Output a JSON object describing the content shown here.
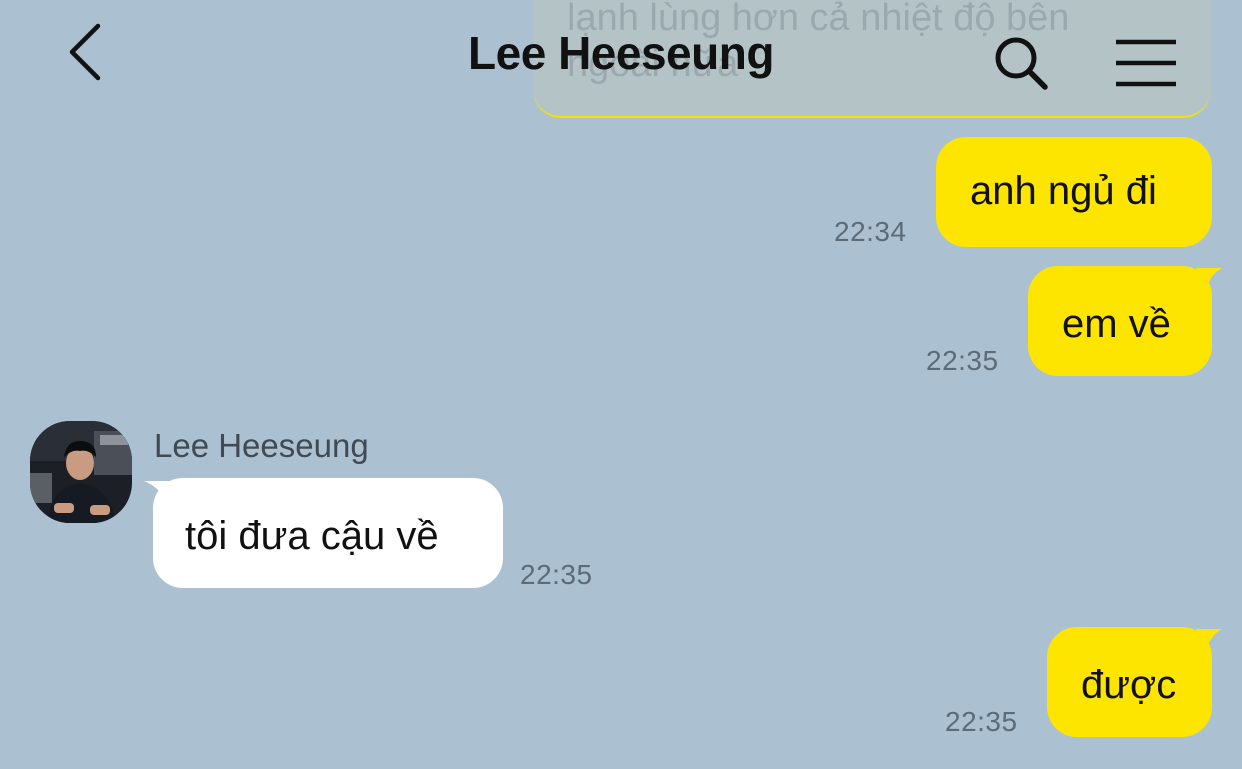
{
  "header": {
    "title": "Lee Heeseung",
    "back_icon": "chevron-left-icon",
    "search_icon": "search-icon",
    "menu_icon": "hamburger-menu-icon"
  },
  "previous_message": {
    "line1": "lạnh lùng hơn cả nhiệt độ bên",
    "line2": "ngoài nữa"
  },
  "messages": [
    {
      "sender": "me",
      "text": "anh ngủ đi",
      "time": "22:34"
    },
    {
      "sender": "me",
      "text": "em về",
      "time": "22:35"
    },
    {
      "sender": "them",
      "name": "Lee Heeseung",
      "text": "tôi đưa cậu về",
      "time": "22:35"
    },
    {
      "sender": "me",
      "text": "được",
      "time": "22:35"
    }
  ],
  "colors": {
    "background": "#abc1d1",
    "my_bubble": "#fee500",
    "their_bubble": "#ffffff",
    "timestamp": "#5d6b76"
  }
}
